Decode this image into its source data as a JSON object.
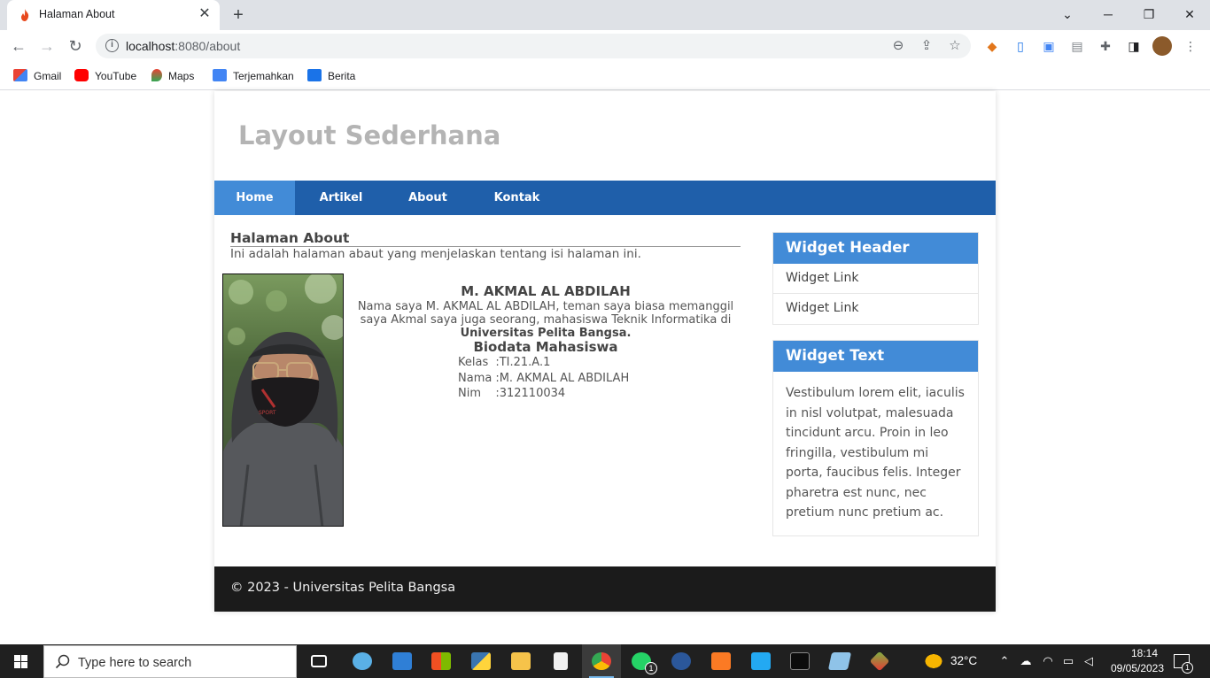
{
  "browser": {
    "tab_title": "Halaman About",
    "tab_close": "✕",
    "new_tab": "+",
    "url_host": "localhost",
    "url_path": ":8080/about",
    "bookmarks": [
      {
        "label": "Gmail"
      },
      {
        "label": "YouTube"
      },
      {
        "label": "Maps"
      },
      {
        "label": "Terjemahkan"
      },
      {
        "label": "Berita"
      }
    ]
  },
  "site": {
    "title": "Layout Sederhana",
    "nav": [
      "Home",
      "Artikel",
      "About",
      "Kontak"
    ],
    "active_nav": "Home"
  },
  "about": {
    "heading": "Halaman About",
    "description": "Ini adalah halaman abaut yang menjelaskan tentang isi halaman ini.",
    "name": "M. AKMAL AL ABDILAH",
    "intro_line1": "Nama saya M. AKMAL AL ABDILAH, teman saya biasa memanggil",
    "intro_line2": "saya Akmal saya juga seorang, mahasiswa Teknik Informatika di",
    "university": "Universitas Pelita Bangsa.",
    "biodata_title": "Biodata Mahasiswa",
    "biodata": [
      {
        "key": "Kelas",
        "value": ":TI.21.A.1"
      },
      {
        "key": "Nama",
        "value": ":M. AKMAL AL ABDILAH"
      },
      {
        "key": "Nim",
        "value": ":312110034"
      }
    ]
  },
  "sidebar": {
    "widget1_header": "Widget Header",
    "widget1_links": [
      "Widget Link",
      "Widget Link"
    ],
    "widget2_header": "Widget Text",
    "widget2_text": "Vestibulum lorem elit, iaculis in nisl volutpat, malesuada tincidunt arcu. Proin in leo fringilla, vestibulum mi porta, faucibus felis. Integer pharetra est nunc, nec pretium nunc pretium ac."
  },
  "footer": {
    "text": "© 2023 - Universitas Pelita Bangsa"
  },
  "taskbar": {
    "search_placeholder": "Type here to search",
    "weather": "32°C",
    "time": "18:14",
    "date": "09/05/2023",
    "whatsapp_badge": "1",
    "notification_badge": "1"
  },
  "colors": {
    "nav_bg": "#1f5faa",
    "nav_active": "#428bd7",
    "widget_head": "#428bd7",
    "footer_bg": "#1b1b1b"
  }
}
